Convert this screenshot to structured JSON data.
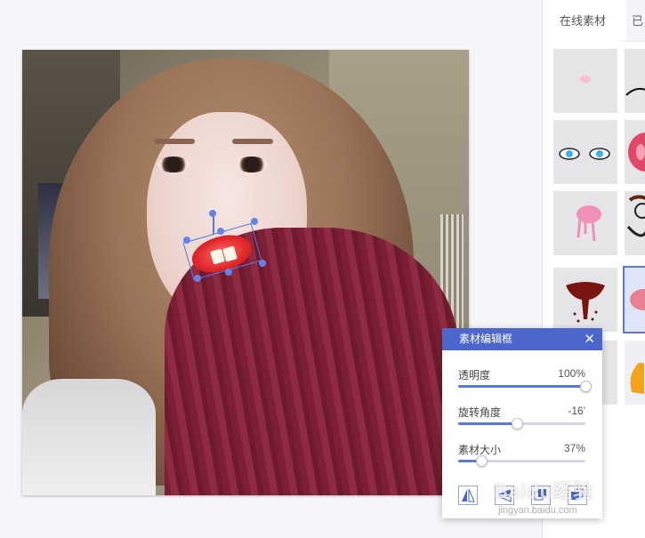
{
  "right_panel": {
    "tabs": [
      {
        "label": "在线素材",
        "active": true
      },
      {
        "label": "已",
        "active": false
      }
    ],
    "thumbnails": [
      {
        "name": "blush-sticker"
      },
      {
        "name": "mustache-sticker"
      },
      {
        "name": "eyes-sticker"
      },
      {
        "name": "pig-nose-sticker"
      },
      {
        "name": "pink-drop-sticker"
      },
      {
        "name": "glasses-face-sticker"
      },
      {
        "name": "mushroom-beard-sticker"
      },
      {
        "name": "lips-sticker",
        "selected": true
      },
      {
        "name": "blank-sticker"
      },
      {
        "name": "hand-sticker"
      }
    ]
  },
  "editor": {
    "title": "素材编辑框",
    "close_icon": "close-icon",
    "opacity": {
      "label": "透明度",
      "value_text": "100%",
      "value": 1.0
    },
    "rotation": {
      "label": "旋转角度",
      "value_text": "-16'",
      "value": 0.46
    },
    "size": {
      "label": "素材大小",
      "value_text": "37%",
      "value": 0.18
    },
    "tools": [
      "flip-horizontal-icon",
      "flip-vertical-icon",
      "bring-forward-icon",
      "send-backward-icon"
    ]
  },
  "watermark": {
    "logo": "Baidu经验",
    "url": "jingyan.baidu.com"
  },
  "colors": {
    "accent": "#4b66cc",
    "slider": "#5b78e0"
  }
}
